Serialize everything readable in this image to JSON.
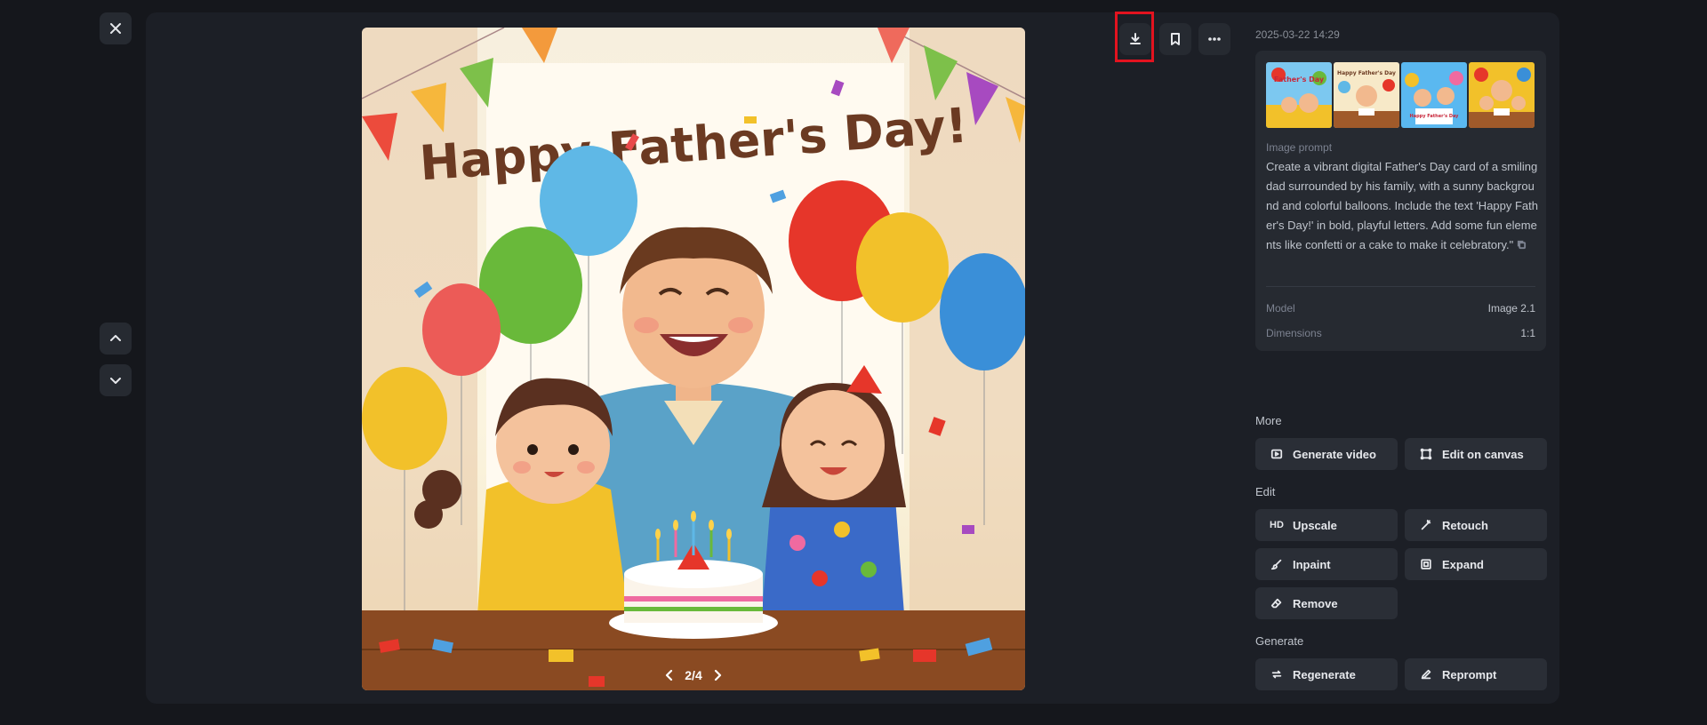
{
  "viewer": {
    "pager": {
      "current": "2/4"
    }
  },
  "card_text": {
    "headline": "Happy Father's Day!"
  },
  "toolbar": {
    "download_icon": "download-icon",
    "bookmark_icon": "bookmark-icon",
    "more_icon": "more-horizontal-icon"
  },
  "details": {
    "timestamp": "2025-03-22 14:29",
    "prompt_label": "Image prompt",
    "prompt_text": "Create a vibrant digital Father's Day card of a smiling dad surrounded by his family, with a sunny background and colorful balloons. Include the text 'Happy Father's Day!' in bold, playful letters. Add some fun elements like confetti or a cake to make it celebratory.\"",
    "thumb_captions": [
      "Father's Day",
      "Happy Father's Day",
      "Happy Father's Day",
      ""
    ],
    "meta": [
      {
        "key": "Model",
        "value": "Image 2.1"
      },
      {
        "key": "Dimensions",
        "value": "1:1"
      }
    ]
  },
  "sections": {
    "more": "More",
    "edit": "Edit",
    "generate": "Generate"
  },
  "actions": {
    "generate_video": "Generate video",
    "edit_on_canvas": "Edit on canvas",
    "upscale_badge": "HD",
    "upscale": "Upscale",
    "retouch": "Retouch",
    "inpaint": "Inpaint",
    "expand": "Expand",
    "remove": "Remove",
    "regenerate": "Regenerate",
    "reprompt": "Reprompt"
  },
  "colors": {
    "background": "#15171c",
    "panel": "#1c1f26",
    "card": "#262a31",
    "highlight": "#e3131f"
  }
}
